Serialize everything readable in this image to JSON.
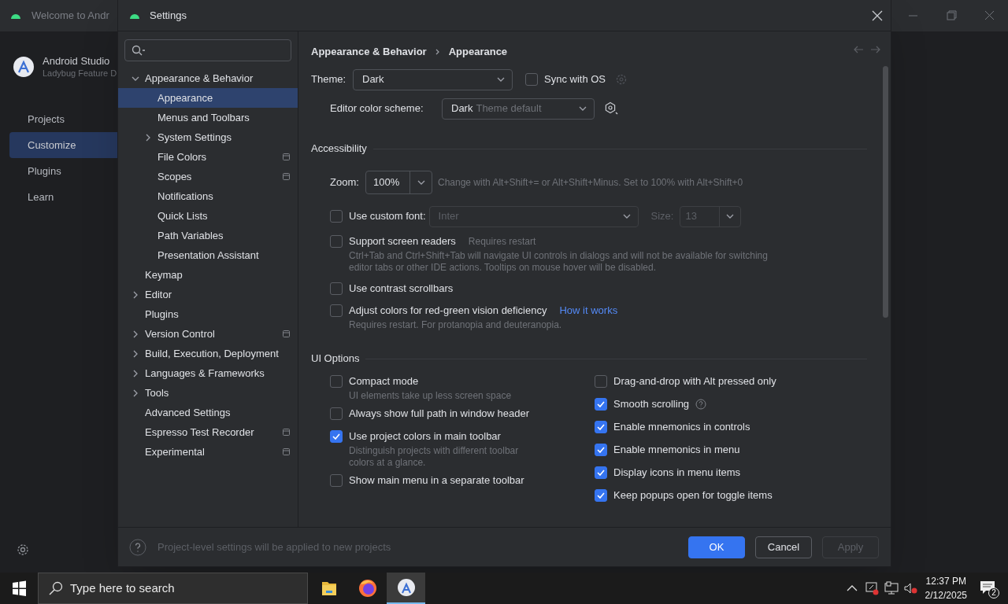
{
  "welcome": {
    "title": "Welcome to Andr",
    "app_name": "Android Studio",
    "version": "Ladybug Feature D",
    "nav": [
      {
        "label": "Projects",
        "selected": false
      },
      {
        "label": "Customize",
        "selected": true
      },
      {
        "label": "Plugins",
        "selected": false
      },
      {
        "label": "Learn",
        "selected": false
      }
    ]
  },
  "dialog": {
    "title": "Settings",
    "tree": [
      {
        "label": "Appearance & Behavior",
        "expanded": true,
        "selected": false,
        "children": [
          {
            "label": "Appearance",
            "selected": true
          },
          {
            "label": "Menus and Toolbars",
            "selected": false
          },
          {
            "label": "System Settings",
            "expanded": false,
            "selected": false
          },
          {
            "label": "File Colors",
            "selected": false,
            "project_level": true
          },
          {
            "label": "Scopes",
            "selected": false,
            "project_level": true
          },
          {
            "label": "Notifications",
            "selected": false
          },
          {
            "label": "Quick Lists",
            "selected": false
          },
          {
            "label": "Path Variables",
            "selected": false
          },
          {
            "label": "Presentation Assistant",
            "selected": false
          }
        ]
      },
      {
        "label": "Keymap",
        "selected": false
      },
      {
        "label": "Editor",
        "expanded": false,
        "selected": false
      },
      {
        "label": "Plugins",
        "selected": false
      },
      {
        "label": "Version Control",
        "expanded": false,
        "selected": false,
        "project_level": true
      },
      {
        "label": "Build, Execution, Deployment",
        "expanded": false,
        "selected": false
      },
      {
        "label": "Languages & Frameworks",
        "expanded": false,
        "selected": false
      },
      {
        "label": "Tools",
        "expanded": false,
        "selected": false
      },
      {
        "label": "Advanced Settings",
        "selected": false
      },
      {
        "label": "Espresso Test Recorder",
        "selected": false,
        "project_level": true
      },
      {
        "label": "Experimental",
        "selected": false,
        "project_level": true
      }
    ],
    "breadcrumb": [
      "Appearance & Behavior",
      "Appearance"
    ],
    "theme": {
      "label": "Theme:",
      "value": "Dark",
      "sync": {
        "label": "Sync with OS",
        "checked": false
      }
    },
    "editor_scheme": {
      "label": "Editor color scheme:",
      "value": "Dark",
      "hint": "Theme default"
    },
    "accessibility": {
      "title": "Accessibility",
      "zoom": {
        "label": "Zoom:",
        "value": "100%",
        "hint": "Change with Alt+Shift+= or Alt+Shift+Minus. Set to 100% with Alt+Shift+0"
      },
      "options": [
        {
          "kind": "font",
          "label": "Use custom font:",
          "checked": false,
          "font": "Inter",
          "size_label": "Size:",
          "size": "13"
        },
        {
          "kind": "check",
          "label": "Support screen readers",
          "checked": false,
          "note": "Requires restart",
          "description": "Ctrl+Tab and Ctrl+Shift+Tab will navigate UI controls in dialogs and will not be available for switching editor tabs or other IDE actions. Tooltips on mouse hover will be disabled."
        },
        {
          "kind": "check",
          "label": "Use contrast scrollbars",
          "checked": false
        },
        {
          "kind": "check",
          "label": "Adjust colors for red-green vision deficiency",
          "checked": false,
          "link": "How it works",
          "description": "Requires restart. For protanopia and deuteranopia."
        }
      ]
    },
    "ui_options": {
      "title": "UI Options",
      "columns": [
        [
          {
            "label": "Compact mode",
            "checked": false,
            "description": "UI elements take up less screen space"
          },
          {
            "label": "Always show full path in window header",
            "checked": false
          },
          {
            "label": "Use project colors in main toolbar",
            "checked": true,
            "description": "Distinguish projects with different toolbar colors at a glance."
          },
          {
            "label": "Show main menu in a separate toolbar",
            "checked": false
          }
        ],
        [
          {
            "label": "Drag-and-drop with Alt pressed only",
            "checked": false
          },
          {
            "label": "Smooth scrolling",
            "checked": true,
            "help": true
          },
          {
            "label": "Enable mnemonics in controls",
            "checked": true
          },
          {
            "label": "Enable mnemonics in menu",
            "checked": true
          },
          {
            "label": "Display icons in menu items",
            "checked": true
          },
          {
            "label": "Keep popups open for toggle items",
            "checked": true
          }
        ]
      ]
    },
    "footer": {
      "note": "Project-level settings will be applied to new projects",
      "buttons": [
        {
          "label": "OK",
          "kind": "primary"
        },
        {
          "label": "Cancel",
          "kind": "normal"
        },
        {
          "label": "Apply",
          "kind": "disabled"
        }
      ]
    }
  },
  "taskbar": {
    "search_placeholder": "Type here to search",
    "apps": [
      {
        "kind": "files",
        "selected": false
      },
      {
        "kind": "firefox",
        "selected": false
      },
      {
        "kind": "studio",
        "selected": true
      }
    ],
    "time": "12:37 PM",
    "date": "2/12/2025",
    "notifications": "2"
  }
}
